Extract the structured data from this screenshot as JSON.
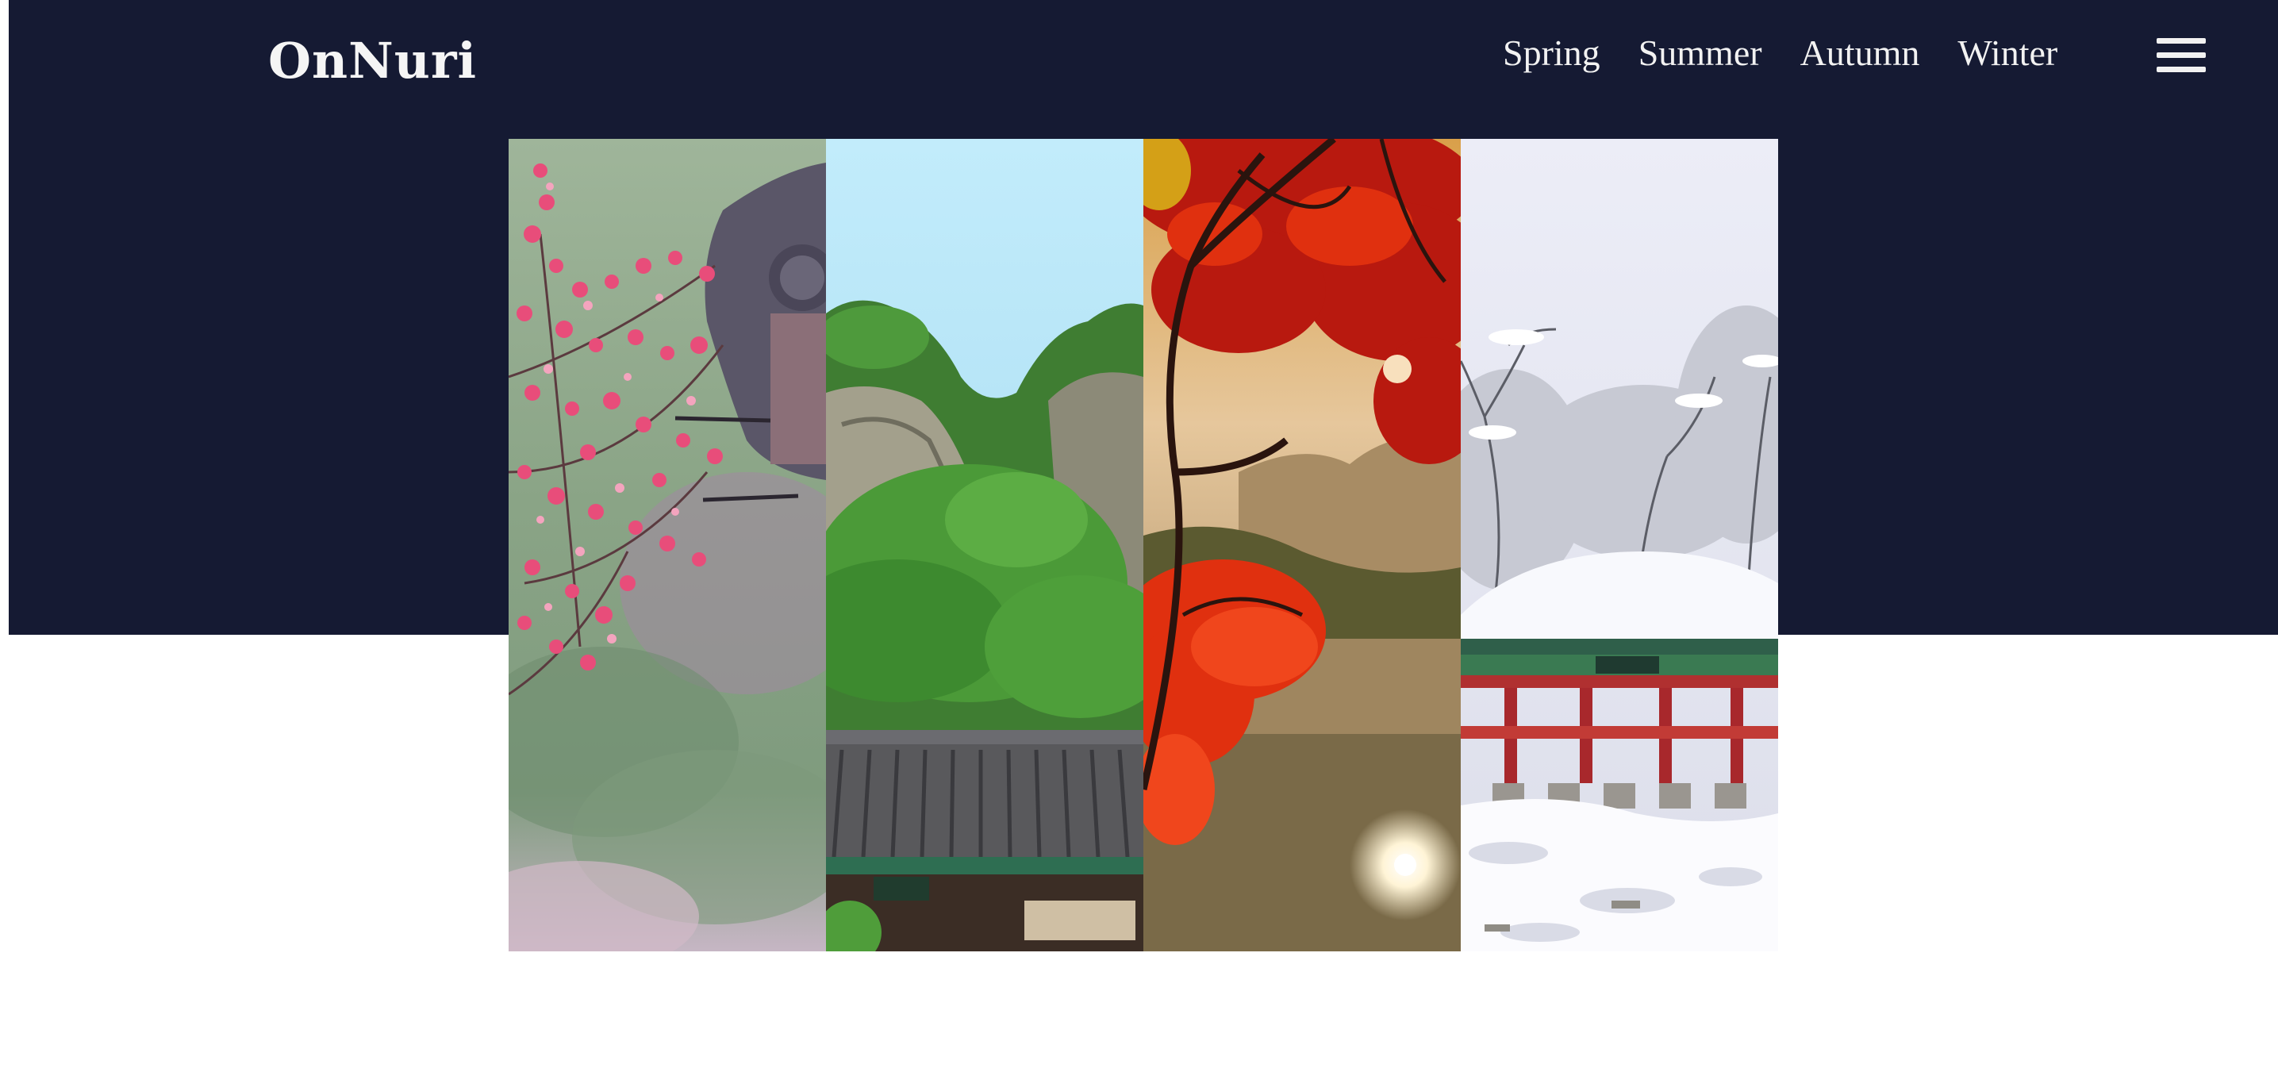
{
  "brand": {
    "logo": "OnNuri"
  },
  "nav": {
    "items": [
      {
        "label": "Spring"
      },
      {
        "label": "Summer"
      },
      {
        "label": "Autumn"
      },
      {
        "label": "Winter"
      }
    ],
    "menu_icon": "hamburger-menu-icon"
  },
  "colors": {
    "hero_background": "#151a33",
    "nav_text": "#f2f2f2",
    "page_background": "#ffffff"
  },
  "gallery": {
    "panels": [
      {
        "season": "spring",
        "image": "pink-plum-blossoms-and-temple-roof-eave"
      },
      {
        "season": "summer",
        "image": "green-mountain-cliffs-and-temple-roof"
      },
      {
        "season": "autumn",
        "image": "red-maple-leaves-over-misty-lake-at-sunrise"
      },
      {
        "season": "winter",
        "image": "snow-covered-pavilion-and-trees"
      }
    ]
  }
}
